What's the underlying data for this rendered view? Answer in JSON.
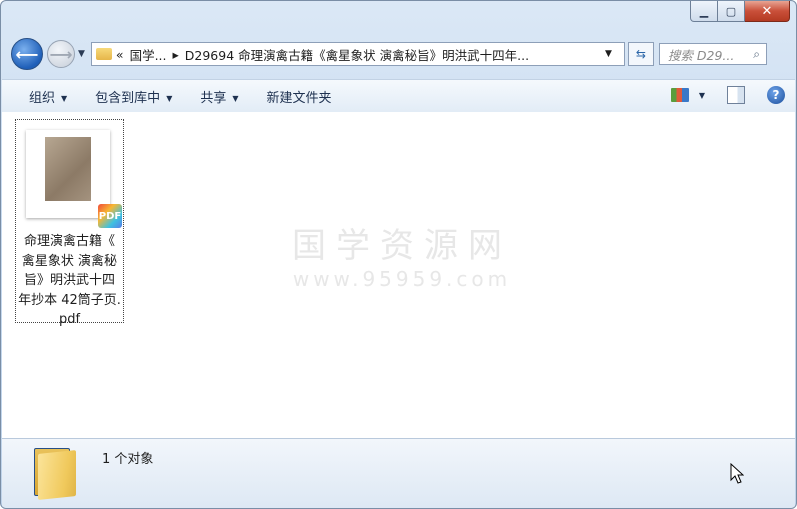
{
  "window": {
    "caption_buttons": {
      "minimize": "▁",
      "maximize": "▢",
      "close": "✕"
    }
  },
  "nav": {
    "back_icon": "arrow-left-icon",
    "forward_icon": "arrow-right-icon",
    "address": {
      "chevron": "«",
      "segment1": "国学...",
      "separator": "▸",
      "segment2": "D29694 命理演禽古籍《禽星象状 演禽秘旨》明洪武十四年..."
    },
    "search_placeholder": "搜索 D29..."
  },
  "toolbar": {
    "organize": "组织",
    "include_library": "包含到库中",
    "share": "共享",
    "new_folder": "新建文件夹"
  },
  "files": [
    {
      "name": "命理演禽古籍《禽星象状 演禽秘旨》明洪武十四年抄本 42筒子页.pdf",
      "label_lines": [
        "命理演禽古籍《",
        "禽星象状 演禽秘",
        "旨》明洪武十四",
        "年抄本 42筒子页.",
        "pdf"
      ],
      "badge": "PDF"
    }
  ],
  "watermark": {
    "line1": "国学资源网",
    "line2": "www.95959.com"
  },
  "status": {
    "count": "1 个对象"
  }
}
